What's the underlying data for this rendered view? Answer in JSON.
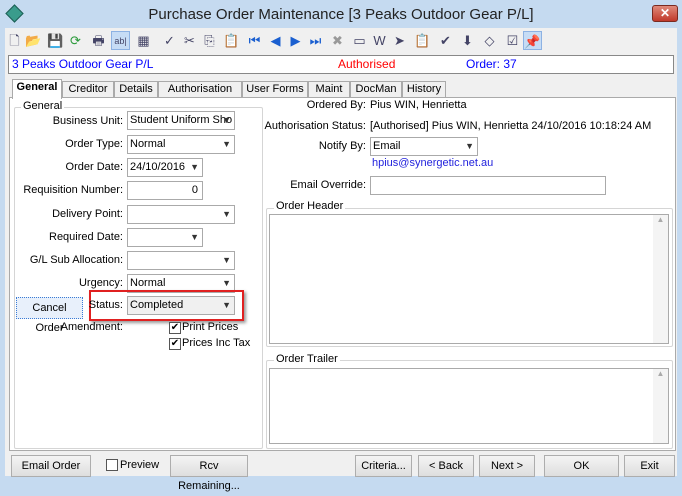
{
  "window": {
    "title": "Purchase Order Maintenance  [3 Peaks Outdoor Gear P/L]",
    "close": "✕"
  },
  "toolbar": [
    {
      "icon": "new-icon",
      "g": "🗋"
    },
    {
      "icon": "open-folder-icon",
      "g": "📂"
    },
    {
      "icon": "save-icon",
      "g": "💾"
    },
    {
      "icon": "refresh-icon",
      "g": "⟳"
    },
    {
      "icon": "print-icon",
      "g": "🖶"
    },
    {
      "icon": "field-icon",
      "g": "ab|"
    },
    {
      "icon": "calculator-icon",
      "g": "▦"
    },
    {
      "icon": "spellcheck-icon",
      "g": "✓"
    },
    {
      "icon": "cut-icon",
      "g": "✂"
    },
    {
      "icon": "copy-icon",
      "g": "⎘"
    },
    {
      "icon": "paste-icon",
      "g": "📋"
    },
    {
      "icon": "first-record-icon",
      "g": "⏮"
    },
    {
      "icon": "previous-record-icon",
      "g": "◀"
    },
    {
      "icon": "next-record-icon",
      "g": "▶"
    },
    {
      "icon": "last-record-icon",
      "g": "⏭"
    },
    {
      "icon": "delete-icon",
      "g": "✖"
    },
    {
      "icon": "form-icon",
      "g": "▭"
    },
    {
      "icon": "word-icon",
      "g": "W"
    },
    {
      "icon": "arrow-icon",
      "g": "➤"
    },
    {
      "icon": "clipboard-icon",
      "g": "📋"
    },
    {
      "icon": "approve-icon",
      "g": "✔"
    },
    {
      "icon": "download-icon",
      "g": "⬇"
    },
    {
      "icon": "tag-icon",
      "g": "◇"
    },
    {
      "icon": "checklist-icon",
      "g": "☑"
    },
    {
      "icon": "pin-icon",
      "g": "📌"
    }
  ],
  "infobar": {
    "company": "3 Peaks Outdoor Gear P/L",
    "status": "Authorised",
    "order": "Order: 37",
    "colors": {
      "company": "#0000ff",
      "status": "#ff0000",
      "order": "#0000ff"
    }
  },
  "tabs": [
    "General",
    "Creditor",
    "Details",
    "Authorisation",
    "User Forms",
    "Maint",
    "DocMan",
    "History"
  ],
  "general": {
    "group_label": "General",
    "business_unit": {
      "label": "Business Unit:",
      "value": "Student Uniform Sho"
    },
    "order_type": {
      "label": "Order Type:",
      "value": "Normal"
    },
    "order_date": {
      "label": "Order Date:",
      "value": "24/10/2016"
    },
    "requisition": {
      "label": "Requisition Number:",
      "value": "0"
    },
    "delivery_point": {
      "label": "Delivery Point:",
      "value": ""
    },
    "required_date": {
      "label": "Required Date:",
      "value": ""
    },
    "gl_sub": {
      "label": "G/L Sub Allocation:",
      "value": ""
    },
    "urgency": {
      "label": "Urgency:",
      "value": "Normal"
    },
    "status": {
      "label": "Status:",
      "value": "Completed"
    },
    "cancel_order": "Cancel Order",
    "amendment": "Amendment:",
    "print_prices": {
      "label": "Print Prices",
      "checked": true
    },
    "prices_inc_tax": {
      "label": "Prices Inc Tax",
      "checked": true
    }
  },
  "right": {
    "ordered_by": {
      "label": "Ordered By:",
      "value": "Pius WIN, Henrietta"
    },
    "auth_status": {
      "label": "Authorisation Status:",
      "value": "[Authorised] Pius WIN, Henrietta 24/10/2016  10:18:24 AM"
    },
    "notify_by": {
      "label": "Notify By:",
      "value": "Email"
    },
    "email": "hpius@synergetic.net.au",
    "email_override": {
      "label": "Email Override:",
      "value": ""
    },
    "order_header": "Order Header",
    "order_trailer": "Order Trailer"
  },
  "footer": {
    "email_order": "Email Order",
    "preview": "Preview",
    "rcv_remaining": "Rcv Remaining...",
    "criteria": "Criteria...",
    "back": "< Back",
    "next": "Next >",
    "ok": "OK",
    "exit": "Exit"
  }
}
